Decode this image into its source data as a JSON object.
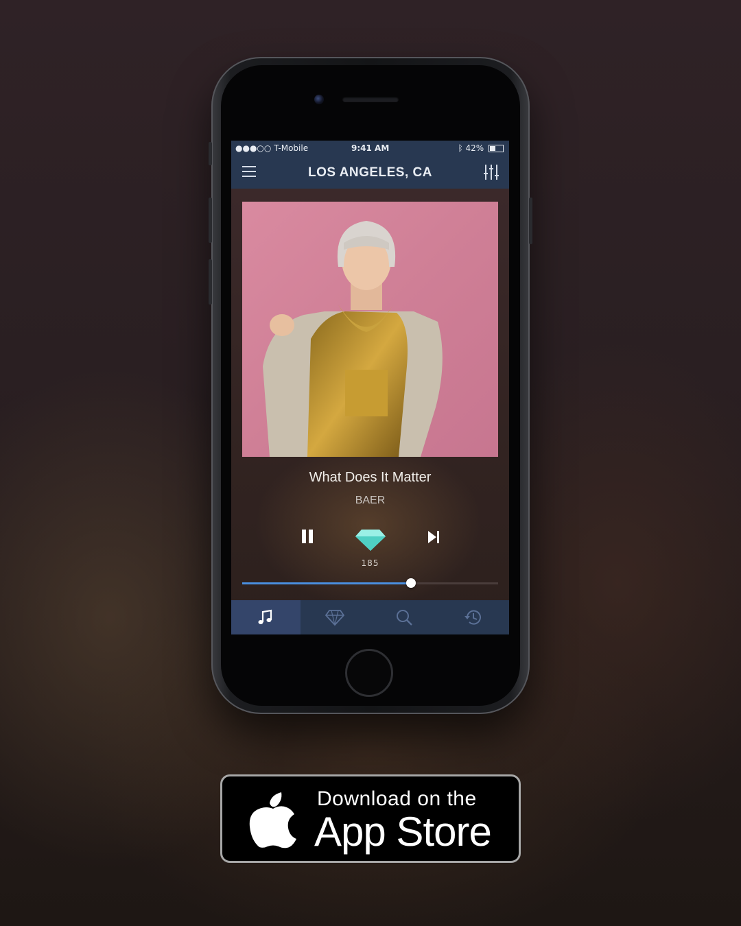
{
  "status_bar": {
    "carrier": "●●●○○ T-Mobile",
    "time": "9:41 AM",
    "battery": "42%"
  },
  "header": {
    "title": "LOS ANGELES, CA",
    "menu_icon": "hamburger-icon",
    "filter_icon": "sliders-icon"
  },
  "player": {
    "track_title": "What Does It Matter",
    "artist": "BAER",
    "gem_count": "185",
    "progress": 0.66
  },
  "tab_bar": {
    "tabs": [
      {
        "icon": "music-note-icon",
        "active": true
      },
      {
        "icon": "diamond-icon",
        "active": false
      },
      {
        "icon": "search-icon",
        "active": false
      },
      {
        "icon": "history-icon",
        "active": false
      }
    ]
  },
  "badge": {
    "line1": "Download on the",
    "line2": "App Store"
  },
  "colors": {
    "nav_bg": "#283851",
    "accent_blue": "#4a8fe0",
    "gem": "#63e3d6"
  }
}
